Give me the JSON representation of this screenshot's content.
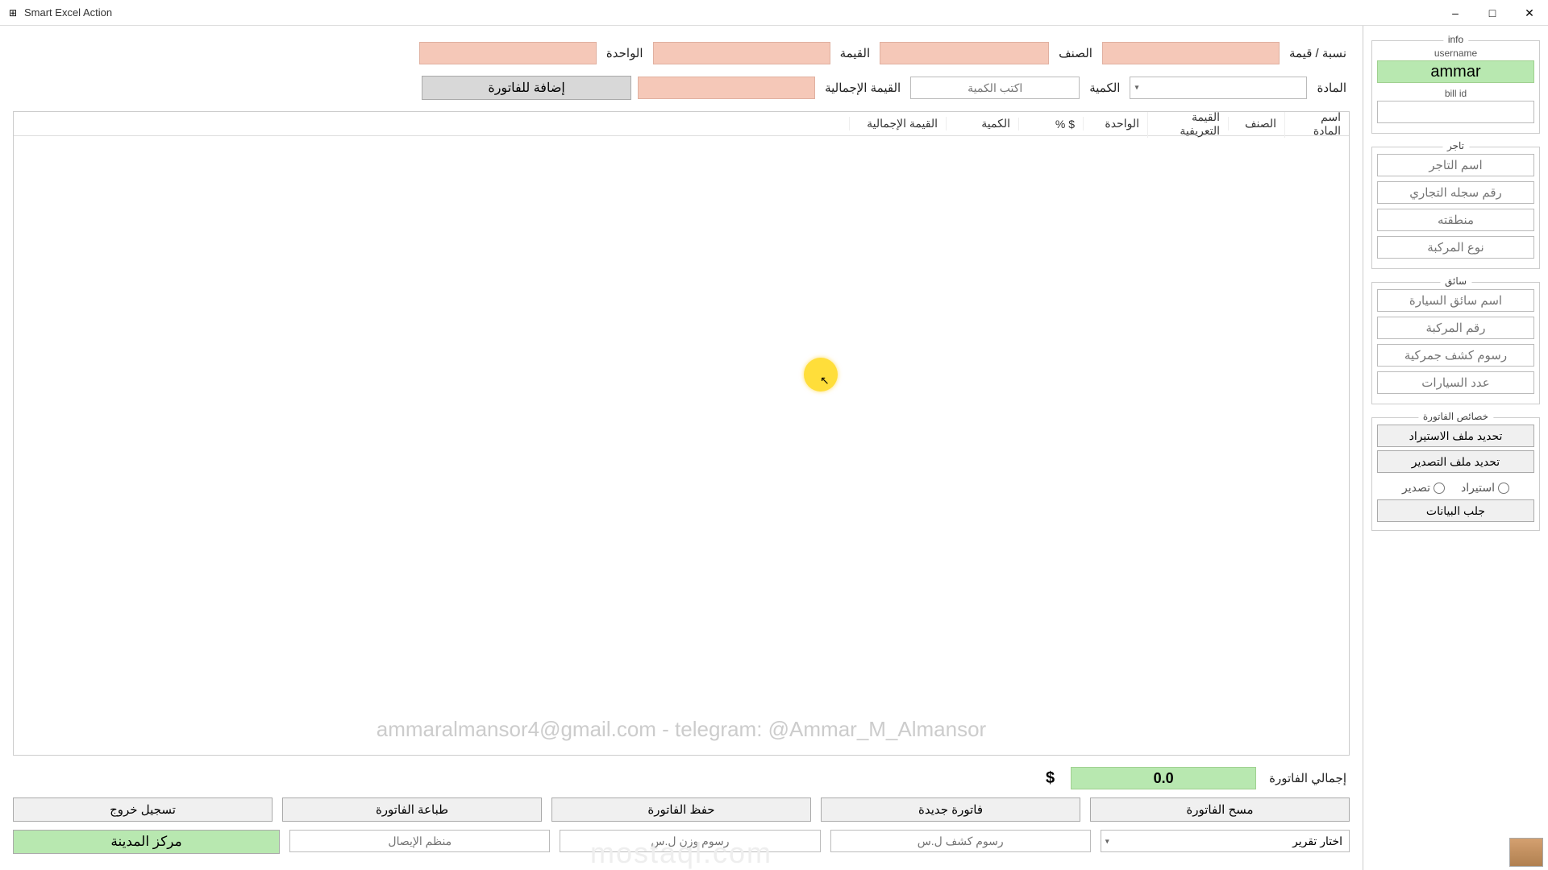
{
  "window": {
    "title": "Smart Excel Action",
    "minimize": "–",
    "maximize": "□",
    "close": "✕"
  },
  "top_inputs": {
    "ratio_value_label": "نسبة / قيمة",
    "class_label": "الصنف",
    "value_label": "القيمة",
    "unit_label": "الواحدة",
    "material_label": "المادة",
    "quantity_label": "الكمية",
    "quantity_placeholder": "اكتب الكمية",
    "total_value_label": "القيمة الإجمالية",
    "add_to_invoice": "إضافة للفاتورة"
  },
  "table": {
    "col_material_name": "اسم المادة",
    "col_class": "الصنف",
    "col_tariff_value": "القيمة التعريفية",
    "col_unit": "الواحدة",
    "col_dollar_pct": "$ %",
    "col_quantity": "الكمية",
    "col_total_value": "القيمة الإجمالية"
  },
  "watermark": "ammaralmansor4@gmail.com - telegram: @Ammar_M_Almansor",
  "footer_watermark": "mostaql.com",
  "totals": {
    "invoice_total_label": "إجمالي الفاتورة",
    "invoice_total_value": "0.0",
    "currency": "$"
  },
  "action_buttons": {
    "clear_invoice": "مسح الفاتورة",
    "new_invoice": "فاتورة جديدة",
    "save_invoice": "حفظ الفاتورة",
    "print_invoice": "طباعة الفاتورة",
    "logout": "تسجيل خروج"
  },
  "report_row": {
    "choose_report": "اختار تقرير",
    "customs_fees": "رسوم كشف ل.س",
    "weight_fees": "رسوم وزن ل.س",
    "receipt_organizer": "منظم الإيصال",
    "city_center": "مركز المدينة"
  },
  "sidebar": {
    "info_legend": "info",
    "username_label": "username",
    "username_value": "ammar",
    "bill_id_label": "bill id",
    "merchant_legend": "تاجر",
    "merchant_name_ph": "اسم التاجر",
    "merchant_reg_ph": "رقم سجله التجاري",
    "merchant_region_ph": "منطقته",
    "vehicle_type_ph": "نوع المركبة",
    "driver_legend": "سائق",
    "driver_name_ph": "اسم سائق السيارة",
    "vehicle_no_ph": "رقم المركبة",
    "customs_fees_ph": "رسوم كشف جمركية",
    "car_count_ph": "عدد السيارات",
    "invoice_props_legend": "خصائص الفاتورة",
    "import_file_btn": "تحديد ملف الاستيراد",
    "export_file_btn": "تحديد ملف التصدير",
    "import_radio": "استيراد",
    "export_radio": "تصدير",
    "fetch_data_btn": "جلب البيانات"
  }
}
